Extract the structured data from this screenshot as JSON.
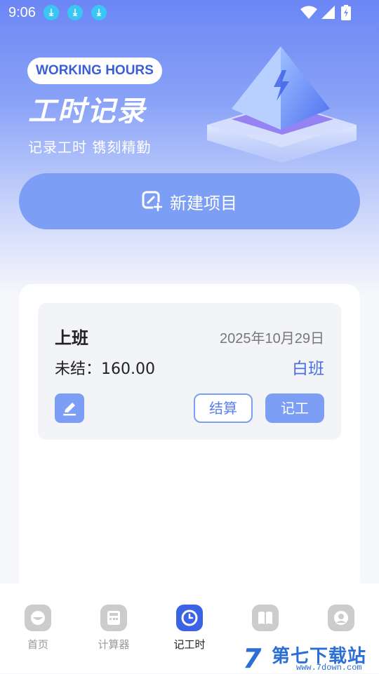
{
  "status_bar": {
    "time": "9:06",
    "notifications": [
      "download-icon",
      "download-icon",
      "download-icon"
    ]
  },
  "hero": {
    "tag": "WORKING HOURS",
    "title": "工时记录",
    "subtitle": "记录工时  镌刻精勤"
  },
  "new_project": {
    "label": "新建项目"
  },
  "project": {
    "name": "上班",
    "date": "2025年10月29日",
    "unsettled": "未结：160.00",
    "shift": "白班",
    "settle_label": "结算",
    "record_label": "记工"
  },
  "tabs": [
    {
      "label": "首页",
      "icon": "home-icon",
      "active": false
    },
    {
      "label": "计算器",
      "icon": "calculator-icon",
      "active": false
    },
    {
      "label": "记工时",
      "icon": "clock-icon",
      "active": true
    },
    {
      "label": "",
      "icon": "book-icon",
      "active": false
    },
    {
      "label": "",
      "icon": "user-icon",
      "active": false
    }
  ],
  "watermark": {
    "text": "第七下载站",
    "url": "www.7down.com"
  },
  "colors": {
    "accent": "#7c9ff5",
    "active_tab": "#3b63e6",
    "shift_text": "#4a6ee6"
  }
}
